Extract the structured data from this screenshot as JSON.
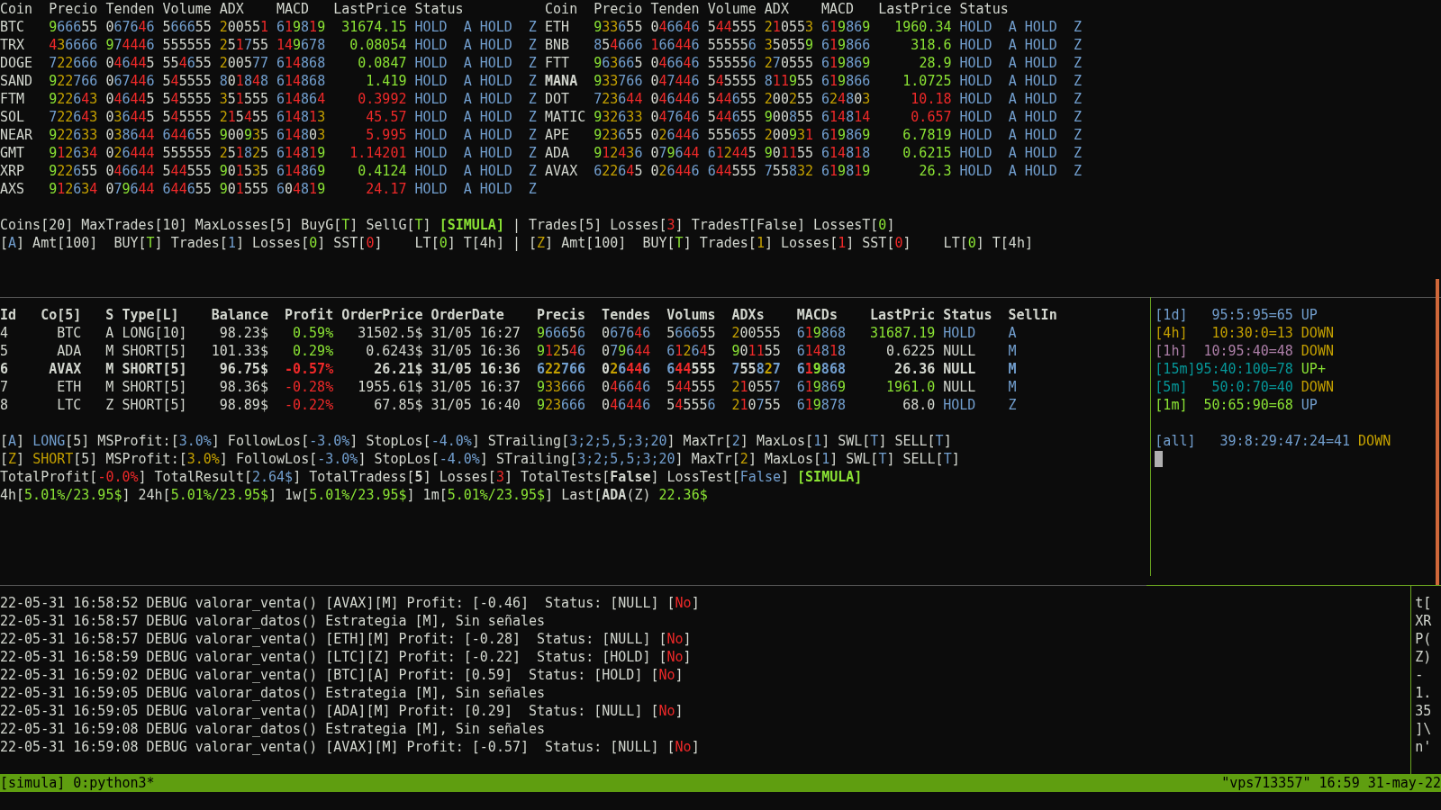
{
  "top_tables": [
    {
      "columns": [
        "Coin",
        "Precio",
        "Tenden",
        "Volume",
        "ADX",
        "MACD",
        "LastPrice",
        "Status"
      ],
      "rows": [
        {
          "coin": "BTC",
          "bold": false,
          "values": [
            "966655",
            "067646",
            "566655",
            "200551",
            "619819"
          ],
          "last_price": "31674.15",
          "rising": true,
          "tail": [
            "HOLD",
            "A",
            "HOLD",
            "Z"
          ]
        },
        {
          "coin": "TRX",
          "bold": false,
          "values": [
            "436666",
            "974446",
            "555555",
            "251755",
            "149678"
          ],
          "last_price": "0.08054",
          "rising": true,
          "tail": [
            "HOLD",
            "A",
            "HOLD",
            "Z"
          ]
        },
        {
          "coin": "DOGE",
          "bold": false,
          "values": [
            "722666",
            "046445",
            "554655",
            "200577",
            "614868"
          ],
          "last_price": "0.0847",
          "rising": true,
          "tail": [
            "HOLD",
            "A",
            "HOLD",
            "Z"
          ]
        },
        {
          "coin": "SAND",
          "bold": false,
          "values": [
            "922766",
            "067446",
            "545555",
            "801848",
            "614868"
          ],
          "last_price": "1.419",
          "rising": true,
          "tail": [
            "HOLD",
            "A",
            "HOLD",
            "Z"
          ]
        },
        {
          "coin": "FTM",
          "bold": false,
          "values": [
            "922643",
            "046445",
            "545555",
            "351555",
            "614864"
          ],
          "last_price": "0.3992",
          "rising": false,
          "tail": [
            "HOLD",
            "A",
            "HOLD",
            "Z"
          ]
        },
        {
          "coin": "SOL",
          "bold": false,
          "values": [
            "722643",
            "036445",
            "545555",
            "215455",
            "614813"
          ],
          "last_price": "45.57",
          "rising": false,
          "tail": [
            "HOLD",
            "A",
            "HOLD",
            "Z"
          ]
        },
        {
          "coin": "NEAR",
          "bold": false,
          "values": [
            "922633",
            "038644",
            "644655",
            "900935",
            "614803"
          ],
          "last_price": "5.995",
          "rising": false,
          "tail": [
            "HOLD",
            "A",
            "HOLD",
            "Z"
          ]
        },
        {
          "coin": "GMT",
          "bold": false,
          "values": [
            "912634",
            "026444",
            "555555",
            "251825",
            "614819"
          ],
          "last_price": "1.14201",
          "rising": false,
          "tail": [
            "HOLD",
            "A",
            "HOLD",
            "Z"
          ]
        },
        {
          "coin": "XRP",
          "bold": false,
          "values": [
            "922655",
            "046644",
            "544555",
            "901535",
            "614869"
          ],
          "last_price": "0.4124",
          "rising": true,
          "tail": [
            "HOLD",
            "A",
            "HOLD",
            "Z"
          ]
        },
        {
          "coin": "AXS",
          "bold": false,
          "values": [
            "912634",
            "079644",
            "644655",
            "901555",
            "604819"
          ],
          "last_price": "24.17",
          "rising": false,
          "tail": [
            "HOLD",
            "A",
            "HOLD",
            "Z"
          ]
        }
      ]
    },
    {
      "columns": [
        "Coin",
        "Precio",
        "Tenden",
        "Volume",
        "ADX",
        "MACD",
        "LastPrice",
        "Status"
      ],
      "rows": [
        {
          "coin": "ETH",
          "bold": false,
          "values": [
            "933655",
            "046646",
            "544555",
            "210553",
            "619869"
          ],
          "last_price": "1960.34",
          "rising": true,
          "tail": [
            "HOLD",
            "A",
            "HOLD",
            "Z"
          ]
        },
        {
          "coin": "BNB",
          "bold": false,
          "values": [
            "854666",
            "166446",
            "555556",
            "350559",
            "619866"
          ],
          "last_price": "318.6",
          "rising": true,
          "tail": [
            "HOLD",
            "A",
            "HOLD",
            "Z"
          ]
        },
        {
          "coin": "FTT",
          "bold": false,
          "values": [
            "963665",
            "046646",
            "555556",
            "270555",
            "619869"
          ],
          "last_price": "28.9",
          "rising": true,
          "tail": [
            "HOLD",
            "A",
            "HOLD",
            "Z"
          ]
        },
        {
          "coin": "MANA",
          "bold": true,
          "values": [
            "933766",
            "047446",
            "545555",
            "811955",
            "619866"
          ],
          "last_price": "1.0725",
          "rising": true,
          "tail": [
            "HOLD",
            "A",
            "HOLD",
            "Z"
          ]
        },
        {
          "coin": "DOT",
          "bold": false,
          "values": [
            "723644",
            "046446",
            "544655",
            "200255",
            "624803"
          ],
          "last_price": "10.18",
          "rising": false,
          "tail": [
            "HOLD",
            "A",
            "HOLD",
            "Z"
          ]
        },
        {
          "coin": "MATIC",
          "bold": false,
          "values": [
            "932633",
            "047646",
            "544655",
            "900855",
            "614814"
          ],
          "last_price": "0.657",
          "rising": false,
          "tail": [
            "HOLD",
            "A",
            "HOLD",
            "Z"
          ]
        },
        {
          "coin": "APE",
          "bold": false,
          "values": [
            "923655",
            "026446",
            "555655",
            "200931",
            "619869"
          ],
          "last_price": "6.7819",
          "rising": true,
          "tail": [
            "HOLD",
            "A",
            "HOLD",
            "Z"
          ]
        },
        {
          "coin": "ADA",
          "bold": false,
          "values": [
            "912436",
            "079644",
            "612445",
            "901155",
            "614818"
          ],
          "last_price": "0.6215",
          "rising": true,
          "tail": [
            "HOLD",
            "A",
            "HOLD",
            "Z"
          ]
        },
        {
          "coin": "AVAX",
          "bold": false,
          "values": [
            "622645",
            "026446",
            "644555",
            "755832",
            "619819"
          ],
          "last_price": "26.3",
          "rising": true,
          "tail": [
            "HOLD",
            "A",
            "HOLD",
            "Z"
          ]
        }
      ]
    }
  ],
  "summary_lines": [
    [
      {
        "t": "Coins[20] MaxTrades[10] MaxLosses[5] BuyG["
      },
      {
        "t": "T",
        "color": "#8ae234"
      },
      {
        "t": "] SellG["
      },
      {
        "t": "T",
        "color": "#8ae234"
      },
      {
        "t": "] "
      },
      {
        "t": "[SIMULA]",
        "color": "#8ae234",
        "bold": true
      },
      {
        "t": " | Trades[5] Losses["
      },
      {
        "t": "3",
        "color": "#ef2929"
      },
      {
        "t": "] TradesT[False] LossesT["
      },
      {
        "t": "0",
        "color": "#8ae234"
      },
      {
        "t": "]"
      }
    ],
    [
      {
        "t": "["
      },
      {
        "t": "A",
        "color": "#729fcf"
      },
      {
        "t": "] Amt[100]  BUY["
      },
      {
        "t": "T",
        "color": "#8ae234"
      },
      {
        "t": "] Trades["
      },
      {
        "t": "1",
        "color": "#729fcf"
      },
      {
        "t": "] Losses["
      },
      {
        "t": "0",
        "color": "#8ae234"
      },
      {
        "t": "] SST["
      },
      {
        "t": "0",
        "color": "#ef2929"
      },
      {
        "t": "]    LT["
      },
      {
        "t": "0",
        "color": "#8ae234"
      },
      {
        "t": "] T[4h] | ["
      },
      {
        "t": "Z",
        "color": "#c4a000"
      },
      {
        "t": "] Amt[100]  BUY["
      },
      {
        "t": "T",
        "color": "#8ae234"
      },
      {
        "t": "] Trades["
      },
      {
        "t": "1",
        "color": "#c4a000"
      },
      {
        "t": "] Losses["
      },
      {
        "t": "1",
        "color": "#ef2929"
      },
      {
        "t": "] SST["
      },
      {
        "t": "0",
        "color": "#ef2929"
      },
      {
        "t": "]    LT["
      },
      {
        "t": "0",
        "color": "#8ae234"
      },
      {
        "t": "] T[4h]"
      }
    ]
  ],
  "orders": {
    "columns": [
      "Id",
      "Co[5]",
      "S",
      "Type[L]",
      "Balance",
      "Profit",
      "OrderPrice",
      "OrderDate",
      "Precis",
      "Tendes",
      "Volums",
      "ADXs",
      "MACDs",
      "LastPric",
      "Status",
      "SellIn"
    ],
    "rows": [
      {
        "id": "4",
        "coin": "BTC",
        "side": "A",
        "type": "LONG[10]",
        "balance": "98.23$",
        "profit": "0.59%",
        "profit_positive": true,
        "order_price": "31502.5$",
        "order_date": "31/05 16:27",
        "indicators": [
          "966656",
          "067646",
          "566655",
          "200555",
          "619868"
        ],
        "last_price": "31687.19",
        "price_rising": true,
        "status": "HOLD",
        "held": true,
        "sell_in": "A",
        "bold": false
      },
      {
        "id": "5",
        "coin": "ADA",
        "side": "M",
        "type": "SHORT[5]",
        "balance": "101.33$",
        "profit": "0.29%",
        "profit_positive": true,
        "order_price": "0.6243$",
        "order_date": "31/05 16:36",
        "indicators": [
          "912546",
          "079644",
          "612645",
          "901155",
          "614818"
        ],
        "last_price": "0.6225",
        "price_rising": false,
        "status": "NULL",
        "held": false,
        "sell_in": "M",
        "bold": false
      },
      {
        "id": "6",
        "coin": "AVAX",
        "side": "M",
        "type": "SHORT[5]",
        "balance": "96.75$",
        "profit": "-0.57%",
        "profit_positive": false,
        "order_price": "26.21$",
        "order_date": "31/05 16:36",
        "indicators": [
          "622766",
          "026446",
          "644555",
          "755827",
          "619868"
        ],
        "last_price": "26.36",
        "price_rising": false,
        "status": "NULL",
        "held": false,
        "sell_in": "M",
        "bold": true
      },
      {
        "id": "7",
        "coin": "ETH",
        "side": "M",
        "type": "SHORT[5]",
        "balance": "98.36$",
        "profit": "-0.28%",
        "profit_positive": false,
        "order_price": "1955.61$",
        "order_date": "31/05 16:37",
        "indicators": [
          "933666",
          "046646",
          "544555",
          "210557",
          "619869"
        ],
        "last_price": "1961.0",
        "price_rising": true,
        "status": "NULL",
        "held": false,
        "sell_in": "M",
        "bold": false
      },
      {
        "id": "8",
        "coin": "LTC",
        "side": "Z",
        "type": "SHORT[5]",
        "balance": "98.89$",
        "profit": "-0.22%",
        "profit_positive": false,
        "order_price": "67.85$",
        "order_date": "31/05 16:40",
        "indicators": [
          "923666",
          "046446",
          "545556",
          "210755",
          "619878"
        ],
        "last_price": "68.0",
        "price_rising": false,
        "status": "HOLD",
        "held": true,
        "sell_in": "Z",
        "bold": false
      }
    ]
  },
  "strategy_lines": [
    [
      {
        "t": "["
      },
      {
        "t": "A",
        "color": "#729fcf"
      },
      {
        "t": "] "
      },
      {
        "t": "LONG",
        "color": "#729fcf"
      },
      {
        "t": "[5] MSProfit:["
      },
      {
        "t": "3.0%",
        "color": "#729fcf"
      },
      {
        "t": "] FollowLos["
      },
      {
        "t": "-3.0%",
        "color": "#729fcf"
      },
      {
        "t": "] StopLos["
      },
      {
        "t": "-4.0%",
        "color": "#729fcf"
      },
      {
        "t": "] STrailing["
      },
      {
        "t": "3;2;5,5;3;20",
        "color": "#729fcf"
      },
      {
        "t": "] MaxTr["
      },
      {
        "t": "2",
        "color": "#729fcf"
      },
      {
        "t": "] MaxLos["
      },
      {
        "t": "1",
        "color": "#729fcf"
      },
      {
        "t": "] SWL["
      },
      {
        "t": "T",
        "color": "#729fcf"
      },
      {
        "t": "] SELL["
      },
      {
        "t": "T",
        "color": "#729fcf"
      },
      {
        "t": "]"
      }
    ],
    [
      {
        "t": "["
      },
      {
        "t": "Z",
        "color": "#c4a000"
      },
      {
        "t": "] "
      },
      {
        "t": "SHORT",
        "color": "#c4a000"
      },
      {
        "t": "[5] MSProfit:["
      },
      {
        "t": "3.0%",
        "color": "#c4a000"
      },
      {
        "t": "] FollowLos["
      },
      {
        "t": "-3.0%",
        "color": "#729fcf"
      },
      {
        "t": "] StopLos["
      },
      {
        "t": "-4.0%",
        "color": "#729fcf"
      },
      {
        "t": "] STrailing["
      },
      {
        "t": "3;2;5,5;3;20",
        "color": "#729fcf"
      },
      {
        "t": "] MaxTr["
      },
      {
        "t": "2",
        "color": "#c4a000"
      },
      {
        "t": "] MaxLos["
      },
      {
        "t": "1",
        "color": "#729fcf"
      },
      {
        "t": "] SWL["
      },
      {
        "t": "T",
        "color": "#729fcf"
      },
      {
        "t": "] SELL["
      },
      {
        "t": "T",
        "color": "#729fcf"
      },
      {
        "t": "]"
      }
    ],
    [
      {
        "t": "TotalProfit["
      },
      {
        "t": "-0.0%",
        "color": "#ef2929"
      },
      {
        "t": "] TotalResult["
      },
      {
        "t": "2.64$",
        "color": "#729fcf"
      },
      {
        "t": "] TotalTradess["
      },
      {
        "t": "5",
        "bold": true
      },
      {
        "t": "] Losses["
      },
      {
        "t": "3",
        "color": "#ef2929"
      },
      {
        "t": "] TotalTests["
      },
      {
        "t": "False",
        "bold": true
      },
      {
        "t": "] LossTest["
      },
      {
        "t": "False",
        "color": "#729fcf"
      },
      {
        "t": "] "
      },
      {
        "t": "[SIMULA]",
        "color": "#8ae234",
        "bold": true
      }
    ],
    [
      {
        "t": "4h["
      },
      {
        "t": "5.01%/23.95$",
        "color": "#8ae234"
      },
      {
        "t": "] 24h["
      },
      {
        "t": "5.01%/23.95$",
        "color": "#8ae234"
      },
      {
        "t": "] 1w["
      },
      {
        "t": "5.01%/23.95$",
        "color": "#8ae234"
      },
      {
        "t": "] 1m["
      },
      {
        "t": "5.01%/23.95$",
        "color": "#8ae234"
      },
      {
        "t": "] Last["
      },
      {
        "t": "ADA",
        "bold": true
      },
      {
        "t": "(Z) "
      },
      {
        "t": "22.36$",
        "color": "#8ae234"
      }
    ]
  ],
  "timeframes": [
    {
      "label": "[1d]",
      "score": "95:5:95=65",
      "direction": "UP",
      "rising": true,
      "strong": false,
      "color": "#729fcf"
    },
    {
      "label": "[4h]",
      "score": "10:30:0=13",
      "direction": "DOWN",
      "rising": false,
      "strong": false,
      "color": "#c4a000"
    },
    {
      "label": "[1h]",
      "score": "10:95:40=48",
      "direction": "DOWN",
      "rising": false,
      "strong": false,
      "color": "#ad7fa8"
    },
    {
      "label": "[15m]",
      "score": "95:40:100=78",
      "direction": "UP+",
      "rising": true,
      "strong": true,
      "color": "#06989a"
    },
    {
      "label": "[5m]",
      "score": "50:0:70=40",
      "direction": "DOWN",
      "rising": false,
      "strong": false,
      "color": "#06989a"
    },
    {
      "label": "[1m]",
      "score": "50:65:90=68",
      "direction": "UP",
      "rising": true,
      "strong": false,
      "color": "#8ae234"
    }
  ],
  "timeframe_total": {
    "label": "[all]",
    "score": "39:8:29:47:24=41",
    "direction": "DOWN",
    "rising": false,
    "strong": false,
    "color": "#729fcf"
  },
  "log_lines": [
    [
      {
        "t": "22-05-31 16:58:52 DEBUG valorar_venta() [AVAX][M] Profit: [-0.46]  Status: [NULL] ["
      },
      {
        "t": "No",
        "color": "#ef2929"
      },
      {
        "t": "]"
      }
    ],
    [
      {
        "t": "22-05-31 16:58:57 DEBUG valorar_datos() Estrategia [M], Sin señales"
      }
    ],
    [
      {
        "t": "22-05-31 16:58:57 DEBUG valorar_venta() [ETH][M] Profit: [-0.28]  Status: [NULL] ["
      },
      {
        "t": "No",
        "color": "#ef2929"
      },
      {
        "t": "]"
      }
    ],
    [
      {
        "t": "22-05-31 16:58:59 DEBUG valorar_venta() [LTC][Z] Profit: [-0.22]  Status: [HOLD] ["
      },
      {
        "t": "No",
        "color": "#ef2929"
      },
      {
        "t": "]"
      }
    ],
    [
      {
        "t": "22-05-31 16:59:02 DEBUG valorar_venta() [BTC][A] Profit: [0.59]  Status: [HOLD] ["
      },
      {
        "t": "No",
        "color": "#ef2929"
      },
      {
        "t": "]"
      }
    ],
    [
      {
        "t": "22-05-31 16:59:05 DEBUG valorar_datos() Estrategia [M], Sin señales"
      }
    ],
    [
      {
        "t": "22-05-31 16:59:05 DEBUG valorar_venta() [ADA][M] Profit: [0.29]  Status: [NULL] ["
      },
      {
        "t": "No",
        "color": "#ef2929"
      },
      {
        "t": "]"
      }
    ],
    [
      {
        "t": "22-05-31 16:59:08 DEBUG valorar_datos() Estrategia [M], Sin señales"
      }
    ],
    [
      {
        "t": "22-05-31 16:59:08 DEBUG valorar_venta() [AVAX][M] Profit: [-0.57]  Status: [NULL] ["
      },
      {
        "t": "No",
        "color": "#ef2929"
      },
      {
        "t": "]"
      }
    ]
  ],
  "side_pane_lines": [
    "t[",
    "XR",
    "P(",
    "Z)",
    "-",
    "1.",
    "35",
    "]\\",
    "n'"
  ],
  "status_bar": {
    "session": "[simula] 0:python3*",
    "right": "\"vps713357\" 16:59 31-may-22"
  }
}
